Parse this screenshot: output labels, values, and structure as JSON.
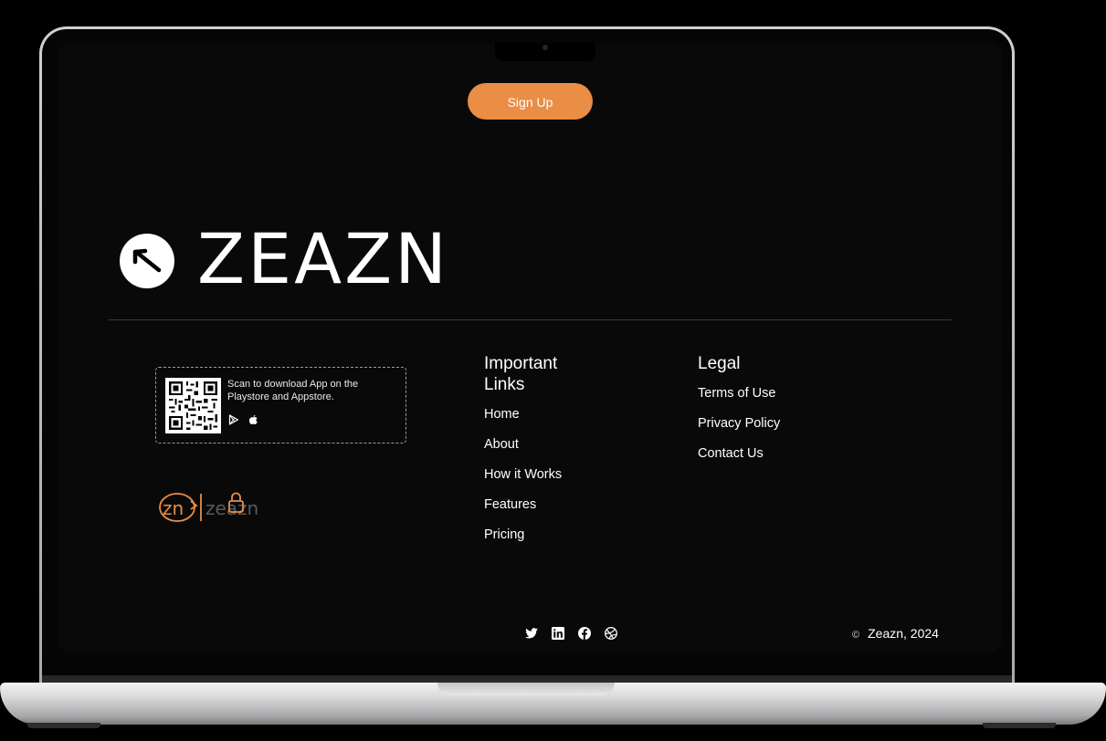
{
  "header": {
    "signup_label": "Sign Up"
  },
  "brand": {
    "name": "ZEAZN",
    "icon": "arrow-up-left-icon"
  },
  "app_download": {
    "text": "Scan to download App on the Playstore and Appstore.",
    "stores": [
      "google-play-icon",
      "apple-icon"
    ]
  },
  "partner_logo": {
    "left_text": "zn",
    "right_text": "zeazn"
  },
  "important_links": {
    "title": "Important Links",
    "items": [
      "Home",
      "About",
      "How it Works",
      "Features",
      "Pricing"
    ]
  },
  "legal": {
    "title": "Legal",
    "items": [
      "Terms of Use",
      "Privacy Policy",
      "Contact Us"
    ]
  },
  "socials": [
    "twitter-icon",
    "linkedin-icon",
    "facebook-icon",
    "dribbble-icon"
  ],
  "copyright": {
    "symbol": "©",
    "text": "Zeazn, 2024"
  },
  "colors": {
    "accent": "#ea8d45",
    "background": "#090909",
    "text": "#ffffff"
  }
}
